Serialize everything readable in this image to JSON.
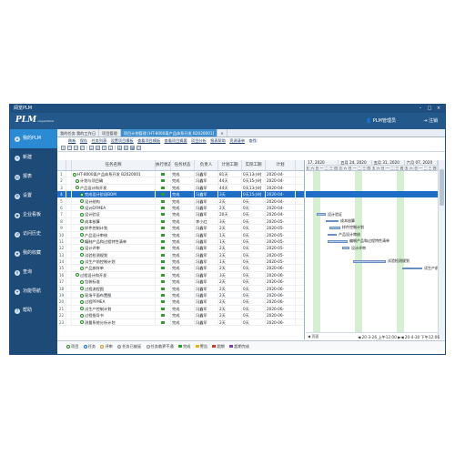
{
  "window": {
    "title": "阅览PLM"
  },
  "header": {
    "logo": "PLM",
    "logo_sub": "cooperation",
    "user": "PLM管理员",
    "logout": "注销"
  },
  "sidebar": {
    "items": [
      {
        "label": "我的PLM",
        "active": true
      },
      {
        "label": "新建"
      },
      {
        "label": "报表"
      },
      {
        "label": "设置"
      },
      {
        "label": "企业看板"
      },
      {
        "label": "访问历史"
      },
      {
        "label": "我的收藏"
      },
      {
        "label": "查询"
      },
      {
        "label": "功能导航"
      },
      {
        "label": "帮助"
      }
    ]
  },
  "tabs": [
    {
      "label": "我的任务 我的工作日"
    },
    {
      "label": "项目管理"
    },
    {
      "label": "项目计划管理 [HT-8000离产品体系开发 B2020001]",
      "active": true
    },
    {
      "label": "×"
    }
  ],
  "menubar": [
    "刷新",
    "保存",
    "任务列表",
    "设置项目模板",
    "查看项目模板",
    "查看项目摘要",
    "项目分析",
    "报表帮助",
    "资源清单",
    "查找:"
  ],
  "grid": {
    "headers": [
      "",
      "",
      "任务名称",
      "执行状态",
      "任务状态",
      "负责人",
      "计划工期",
      "实际工期",
      "计划"
    ],
    "rows": [
      {
        "num": "1",
        "name": "HT-8000离产品体系开发 B2020001",
        "status": "完成",
        "owner": "冯鑫军",
        "plan": "81天",
        "actual": "0天13小时",
        "date": "2020-04-"
      },
      {
        "num": "2",
        "name": "计划与项目确",
        "status": "完成",
        "owner": "冯鑫军",
        "plan": "44天",
        "actual": "0天15小时",
        "date": "2020-04-"
      },
      {
        "num": "3",
        "name": "产品设计和开发",
        "status": "完成",
        "owner": "冯鑫军",
        "plan": "44天",
        "actual": "0天13小时",
        "date": "2020-04-"
      },
      {
        "num": "4",
        "name": "完成设计阶段BOM",
        "status": "完成",
        "owner": "冯鑫军",
        "plan": "3天",
        "actual": "0天15小时",
        "date": "2020-04-",
        "selected": true
      },
      {
        "num": "5",
        "name": "设计结构",
        "status": "完成",
        "owner": "冯鑫军",
        "plan": "2天",
        "actual": "0天",
        "date": "2020-04-"
      },
      {
        "num": "6",
        "name": "设计DFMEA",
        "status": "完成",
        "owner": "冯鑫军",
        "plan": "2天",
        "actual": "0天",
        "date": "2020-04-"
      },
      {
        "num": "7",
        "name": "设计验证",
        "status": "完成",
        "owner": "冯鑫军",
        "plan": "20天",
        "actual": "0天",
        "date": "2020-04-"
      },
      {
        "num": "8",
        "name": "成本核算",
        "status": "完成",
        "owner": "李小红",
        "plan": "3天",
        "actual": "0天",
        "date": "2020-05-"
      },
      {
        "num": "9",
        "name": "样件控制计划",
        "status": "完成",
        "owner": "冯鑫军",
        "plan": "2天",
        "actual": "0天",
        "date": "2020-05-"
      },
      {
        "num": "10",
        "name": "产品设计审核",
        "status": "完成",
        "owner": "冯鑫军",
        "plan": "1天",
        "actual": "0天",
        "date": "2020-05-"
      },
      {
        "num": "11",
        "name": "编制产品和过程特性清单",
        "status": "完成",
        "owner": "冯鑫军",
        "plan": "1天",
        "actual": "0天",
        "date": "2020-05-"
      },
      {
        "num": "12",
        "name": "设计评审",
        "status": "完成",
        "owner": "冯鑫军",
        "plan": "2天",
        "actual": "0天",
        "date": "2020-05-"
      },
      {
        "num": "13",
        "name": "试验检测规划",
        "status": "完成",
        "owner": "冯鑫军",
        "plan": "2天",
        "actual": "0天",
        "date": "2020-05-"
      },
      {
        "num": "14",
        "name": "试生产前控制计划",
        "status": "完成",
        "owner": "冯鑫军",
        "plan": "1天",
        "actual": "0天",
        "date": "2020-05-"
      },
      {
        "num": "15",
        "name": "产品放样单",
        "status": "完成",
        "owner": "冯鑫军",
        "plan": "2天",
        "actual": "0天",
        "date": "2020-06-"
      },
      {
        "num": "16",
        "name": "过程设计和开发",
        "status": "完成",
        "owner": "冯鑫军",
        "plan": "3天",
        "actual": "0天",
        "date": "2020-06-"
      },
      {
        "num": "17",
        "name": "包装标准",
        "status": "完成",
        "owner": "冯鑫军",
        "plan": "2天",
        "actual": "0天",
        "date": "2020-06-"
      },
      {
        "num": "18",
        "name": "过程流程图",
        "status": "完成",
        "owner": "冯鑫军",
        "plan": "2天",
        "actual": "0天",
        "date": "2020-06-"
      },
      {
        "num": "19",
        "name": "现场平面布置图",
        "status": "完成",
        "owner": "冯鑫军",
        "plan": "2天",
        "actual": "0天",
        "date": "2020-06-"
      },
      {
        "num": "20",
        "name": "过程PFMEA",
        "status": "完成",
        "owner": "冯鑫军",
        "plan": "2天",
        "actual": "0天",
        "date": "2020-06-"
      },
      {
        "num": "21",
        "name": "试生产控制计划",
        "status": "完成",
        "owner": "冯鑫军",
        "plan": "2天",
        "actual": "0天",
        "date": "2020-06-"
      },
      {
        "num": "22",
        "name": "过程指导书",
        "status": "完成",
        "owner": "冯鑫军",
        "plan": "2天",
        "actual": "0天",
        "date": "2020-06-"
      },
      {
        "num": "23",
        "name": "测量系统分析计划",
        "status": "完成",
        "owner": "冯鑫军",
        "plan": "2天",
        "actual": "0天",
        "date": "2020-06-"
      }
    ]
  },
  "gantt": {
    "weeks": [
      "17, 2020",
      "五月 24, 2020",
      "五月 31, 2020",
      "六月 07, 2020"
    ],
    "days": [
      "五",
      "六",
      "日",
      "一",
      "二",
      "三",
      "四",
      "五",
      "六",
      "日",
      "一",
      "二",
      "三",
      "四",
      "五",
      "六",
      "日",
      "一",
      "二",
      "三",
      "四",
      "五",
      "六",
      "日",
      "一",
      "二",
      "三",
      "四"
    ],
    "bar_labels": [
      "设计验证",
      "成本核算",
      "样件控制计划",
      "产品设计审核",
      "编制产品和过程特性清单",
      "设计评审",
      "试验检测规划",
      "试生产前控制计划"
    ],
    "footer_left": "◀ 页面",
    "footer_dates_a": "20-3-26 上午12:00",
    "footer_dates_b": "20-4-30 下午12:06"
  },
  "statusbar": {
    "items": [
      "项目",
      "任务",
      "评审",
      "任务已被延",
      "任务临界不通",
      "完成",
      "警告",
      "超期",
      "超期完成"
    ]
  },
  "colors": {
    "header": "#23588b",
    "sidebar": "#1d4a76",
    "accent": "#2a8ad4",
    "selected_row": "#1e6ec5"
  }
}
